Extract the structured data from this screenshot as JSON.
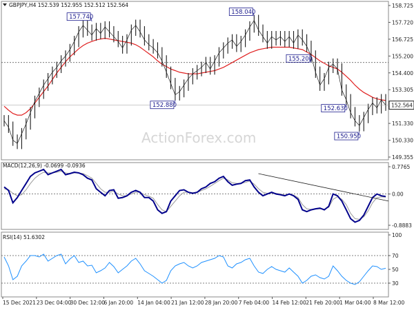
{
  "header": {
    "symbol_line": "GBPJPY,H4  152.539 152.955 152.512 152.564",
    "macd_line": "MACD(12,26,9) -0.0699 -0.0936",
    "rsi_line": "RSI(14) 51.6302"
  },
  "watermark": "ActionForex.com",
  "colors": {
    "price_line": "#1a1a1a",
    "sma": "#e02020",
    "macd": "#00008b",
    "signal": "#9a9a9a",
    "rsi": "#1e90ff",
    "trendline": "#1a1a1a",
    "label_border": "#1a1a8c",
    "label_text": "#1a1a8c",
    "current_price_box": "#1a1a1a"
  },
  "chart_data": {
    "type": "line",
    "x_ticks": [
      "15 Dec 2021",
      "23 Dec 04:00",
      "30 Dec 12:00",
      "6 Jan 20:00",
      "14 Jan 04:00",
      "21 Jan 12:00",
      "28 Jan 20:00",
      "7 Feb 04:00",
      "14 Feb 12:00",
      "21 Feb 20:00",
      "1 Mar 04:00",
      "8 Mar 12:00"
    ],
    "price": {
      "ylim": [
        149.355,
        158.725
      ],
      "y_ticks": [
        "158.725",
        "157.720",
        "156.725",
        "155.200",
        "154.400",
        "153.305",
        "152.305",
        "151.330",
        "150.330",
        "149.355"
      ],
      "close": [
        151.6,
        151.2,
        150.4,
        150.2,
        150.8,
        151.4,
        152.1,
        152.8,
        153.3,
        153.8,
        154.2,
        154.6,
        154.9,
        155.3,
        155.6,
        156.0,
        156.5,
        157.1,
        157.5,
        157.2,
        156.9,
        157.3,
        157.0,
        157.4,
        157.1,
        156.8,
        156.5,
        156.1,
        156.6,
        157.2,
        157.5,
        157.1,
        156.6,
        156.3,
        156.1,
        155.8,
        155.3,
        154.6,
        153.9,
        153.2,
        153.4,
        153.8,
        154.2,
        154.5,
        154.7,
        154.9,
        155.2,
        154.8,
        155.3,
        155.8,
        156.1,
        156.4,
        156.6,
        156.2,
        156.5,
        156.9,
        157.4,
        157.8,
        157.2,
        156.8,
        156.4,
        156.8,
        156.6,
        156.8,
        156.5,
        156.8,
        156.4,
        156.9,
        156.6,
        156.2,
        155.6,
        154.6,
        153.8,
        154.2,
        154.9,
        155.1,
        154.8,
        153.5,
        152.9,
        152.1,
        151.6,
        151.3,
        151.8,
        152.3,
        152.7,
        152.4,
        152.9,
        152.564
      ],
      "sma": [
        152.5,
        152.25,
        152.05,
        151.95,
        151.95,
        152.1,
        152.35,
        152.7,
        153.05,
        153.4,
        153.75,
        154.15,
        154.55,
        154.9,
        155.25,
        155.55,
        155.8,
        156.05,
        156.25,
        156.4,
        156.5,
        156.6,
        156.65,
        156.7,
        156.65,
        156.6,
        156.55,
        156.5,
        156.45,
        156.4,
        156.3,
        156.15,
        155.95,
        155.75,
        155.55,
        155.3,
        155.1,
        154.95,
        154.8,
        154.7,
        154.6,
        154.55,
        154.5,
        154.5,
        154.5,
        154.55,
        154.6,
        154.65,
        154.7,
        154.8,
        154.9,
        155.05,
        155.2,
        155.35,
        155.5,
        155.65,
        155.8,
        155.9,
        156.0,
        156.05,
        156.1,
        156.15,
        156.15,
        156.15,
        156.15,
        156.15,
        156.1,
        156.05,
        156.0,
        155.85,
        155.7,
        155.5,
        155.3,
        155.15,
        155.0,
        154.9,
        154.8,
        154.6,
        154.35,
        154.1,
        153.8,
        153.55,
        153.35,
        153.2,
        153.05,
        152.95,
        152.9,
        152.85
      ],
      "h_line": 155.2,
      "current_price": "152.564",
      "annotations": [
        {
          "text": "157.740",
          "value": 157.74
        },
        {
          "text": "158.040",
          "value": 158.04
        },
        {
          "text": "152.880",
          "value": 152.88
        },
        {
          "text": "155.200",
          "value": 155.2
        },
        {
          "text": "152.630",
          "value": 152.63
        },
        {
          "text": "150.950",
          "value": 150.95
        }
      ]
    },
    "macd": {
      "ylim": [
        -0.8883,
        0.7765
      ],
      "y_ticks": [
        "0.7765",
        "0.00",
        "-0.8883"
      ],
      "macd": [
        0.2,
        0.1,
        -0.25,
        -0.1,
        0.1,
        0.3,
        0.5,
        0.6,
        0.65,
        0.7,
        0.55,
        0.6,
        0.65,
        0.7,
        0.55,
        0.58,
        0.62,
        0.6,
        0.55,
        0.45,
        0.4,
        0.15,
        0.05,
        -0.05,
        0.1,
        0.12,
        -0.12,
        -0.1,
        -0.05,
        0.05,
        0.1,
        0.05,
        -0.1,
        -0.1,
        -0.2,
        -0.45,
        -0.55,
        -0.5,
        -0.2,
        -0.05,
        0.1,
        0.12,
        0.05,
        0.02,
        0.05,
        0.15,
        0.2,
        0.3,
        0.35,
        0.45,
        0.5,
        0.35,
        0.25,
        0.28,
        0.3,
        0.38,
        0.4,
        0.2,
        0.05,
        -0.05,
        0.0,
        0.05,
        0.0,
        -0.02,
        -0.05,
        0.0,
        -0.05,
        -0.15,
        -0.45,
        -0.5,
        -0.45,
        -0.42,
        -0.4,
        -0.45,
        -0.35,
        0.0,
        -0.05,
        -0.2,
        -0.45,
        -0.7,
        -0.8,
        -0.75,
        -0.6,
        -0.35,
        -0.1,
        0.0,
        -0.05,
        -0.07
      ],
      "signal": [
        0.15,
        0.12,
        0.02,
        -0.05,
        -0.02,
        0.12,
        0.3,
        0.45,
        0.55,
        0.62,
        0.6,
        0.6,
        0.62,
        0.65,
        0.6,
        0.58,
        0.6,
        0.6,
        0.58,
        0.52,
        0.45,
        0.3,
        0.15,
        0.05,
        0.05,
        0.08,
        0.0,
        -0.05,
        -0.05,
        0.0,
        0.05,
        0.05,
        -0.02,
        -0.06,
        -0.12,
        -0.3,
        -0.45,
        -0.5,
        -0.35,
        -0.2,
        -0.05,
        0.05,
        0.05,
        0.04,
        0.04,
        0.1,
        0.15,
        0.22,
        0.3,
        0.38,
        0.45,
        0.4,
        0.32,
        0.3,
        0.3,
        0.33,
        0.37,
        0.28,
        0.15,
        0.05,
        0.02,
        0.03,
        0.02,
        0.0,
        -0.03,
        -0.01,
        -0.03,
        -0.1,
        -0.3,
        -0.42,
        -0.44,
        -0.43,
        -0.42,
        -0.43,
        -0.38,
        -0.15,
        -0.08,
        -0.15,
        -0.3,
        -0.55,
        -0.7,
        -0.72,
        -0.65,
        -0.48,
        -0.25,
        -0.1,
        -0.08,
        -0.09
      ],
      "trendline": {
        "x_from": 0.664,
        "x_to": 1.0,
        "y_from": 0.58,
        "y_to": -0.2
      }
    },
    "rsi": {
      "ylim": [
        0,
        100
      ],
      "y_ticks": [
        "100",
        "70",
        "50",
        "30"
      ],
      "levels": [
        30,
        70
      ],
      "values": [
        68,
        55,
        35,
        40,
        55,
        62,
        70,
        70,
        68,
        72,
        62,
        66,
        70,
        72,
        58,
        65,
        70,
        60,
        62,
        55,
        56,
        45,
        48,
        52,
        60,
        54,
        45,
        50,
        55,
        62,
        66,
        58,
        48,
        44,
        40,
        35,
        30,
        34,
        48,
        55,
        58,
        60,
        55,
        52,
        55,
        60,
        62,
        64,
        66,
        70,
        68,
        55,
        52,
        58,
        60,
        64,
        66,
        55,
        46,
        44,
        50,
        54,
        50,
        48,
        46,
        52,
        46,
        40,
        30,
        34,
        40,
        42,
        38,
        36,
        40,
        55,
        48,
        40,
        34,
        30,
        28,
        32,
        40,
        48,
        55,
        54,
        50,
        51.63
      ]
    }
  }
}
